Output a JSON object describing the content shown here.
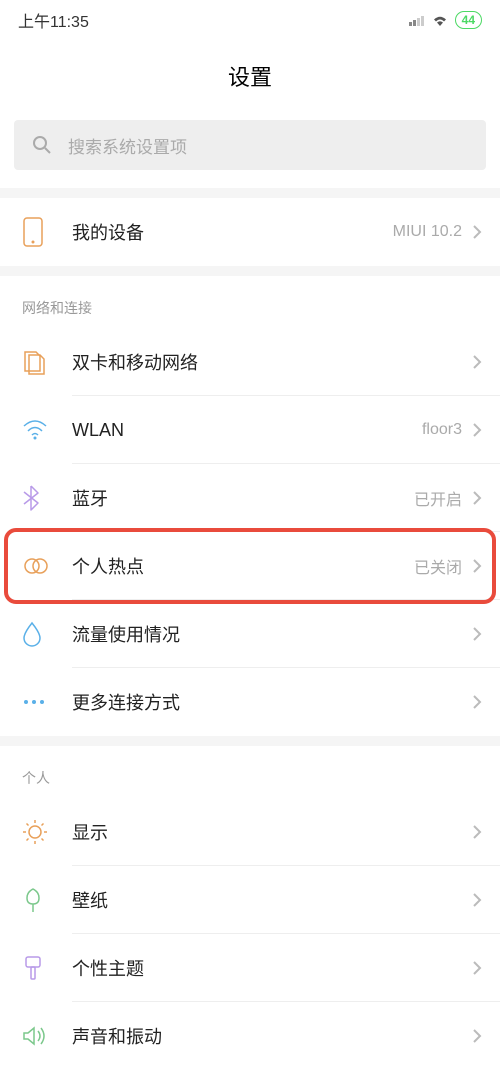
{
  "statusBar": {
    "time": "上午11:35",
    "battery": "44"
  },
  "header": {
    "title": "设置"
  },
  "search": {
    "placeholder": "搜索系统设置项"
  },
  "device": {
    "label": "我的设备",
    "value": "MIUI 10.2"
  },
  "network": {
    "header": "网络和连接",
    "sim": {
      "label": "双卡和移动网络"
    },
    "wlan": {
      "label": "WLAN",
      "value": "floor3"
    },
    "bluetooth": {
      "label": "蓝牙",
      "value": "已开启"
    },
    "hotspot": {
      "label": "个人热点",
      "value": "已关闭"
    },
    "dataUsage": {
      "label": "流量使用情况"
    },
    "more": {
      "label": "更多连接方式"
    }
  },
  "personal": {
    "header": "个人",
    "display": {
      "label": "显示"
    },
    "wallpaper": {
      "label": "壁纸"
    },
    "theme": {
      "label": "个性主题"
    },
    "sound": {
      "label": "声音和振动"
    }
  }
}
